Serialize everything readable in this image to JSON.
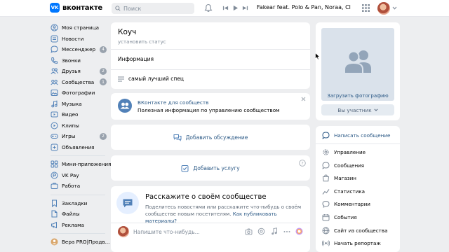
{
  "header": {
    "logo_text": "вконтакте",
    "logo_mark": "VK",
    "search_placeholder": "Поиск",
    "track": "Fakear feat. Polo & Pan, Noraa, Clémence Quélennec"
  },
  "sidebar": {
    "group1": [
      {
        "label": "Моя страница",
        "icon": "user-icon"
      },
      {
        "label": "Новости",
        "icon": "news-icon"
      },
      {
        "label": "Мессенджер",
        "icon": "message-icon",
        "badge": "4"
      },
      {
        "label": "Звонки",
        "icon": "phone-icon"
      },
      {
        "label": "Друзья",
        "icon": "friends-icon",
        "badge": "2"
      },
      {
        "label": "Сообщества",
        "icon": "groups-icon",
        "badge": "1"
      },
      {
        "label": "Фотографии",
        "icon": "photo-icon"
      },
      {
        "label": "Музыка",
        "icon": "music-icon"
      },
      {
        "label": "Видео",
        "icon": "video-icon"
      },
      {
        "label": "Клипы",
        "icon": "clips-icon"
      },
      {
        "label": "Игры",
        "icon": "games-icon",
        "badge": "2"
      },
      {
        "label": "Объявления",
        "icon": "ads-icon"
      }
    ],
    "group2": [
      {
        "label": "Мини-приложения",
        "icon": "apps-icon"
      },
      {
        "label": "VK Pay",
        "icon": "pay-icon"
      },
      {
        "label": "Работа",
        "icon": "work-icon"
      }
    ],
    "group3": [
      {
        "label": "Закладки",
        "icon": "bookmark-icon"
      },
      {
        "label": "Файлы",
        "icon": "files-icon"
      },
      {
        "label": "Реклама",
        "icon": "megaphone-icon"
      }
    ],
    "group4": [
      {
        "label": "Вера PRO|Продв...",
        "icon": "community-icon"
      }
    ]
  },
  "profile": {
    "name": "Коуч",
    "status": "установить статус",
    "info_label": "Информация",
    "description": "самый лучший спец"
  },
  "promo": {
    "title": "ВКонтакте для сообществ",
    "subtitle": "Полезная информация по управлению сообществом"
  },
  "discussion": {
    "label": "Добавить обсуждение"
  },
  "service": {
    "label": "Добавить услугу"
  },
  "tell": {
    "title": "Расскажите о своём сообществе",
    "text": "Поделитесь новостями или расскажите что-нибудь о своём сообществе новым посетителям.",
    "link": "Как публиковать материалы?",
    "post_placeholder": "Напишите что-нибудь..."
  },
  "photo": {
    "upload_label": "Загрузить фотографию",
    "member_label": "Вы участник"
  },
  "menu": {
    "write_label": "Написать сообщение",
    "items": [
      {
        "label": "Управление",
        "icon": "settings-icon"
      },
      {
        "label": "Сообщения",
        "icon": "chat-icon"
      },
      {
        "label": "Магазин",
        "icon": "shop-icon"
      },
      {
        "label": "Статистика",
        "icon": "stats-icon"
      },
      {
        "label": "Комментарии",
        "icon": "comments-icon"
      },
      {
        "label": "События",
        "icon": "events-icon"
      },
      {
        "label": "Сайт из сообщества",
        "icon": "site-icon"
      },
      {
        "label": "Начать репортаж",
        "icon": "live-icon"
      }
    ]
  },
  "colors": {
    "accent": "#2a5885",
    "brand": "#0077ff",
    "background": "#edeef0"
  }
}
